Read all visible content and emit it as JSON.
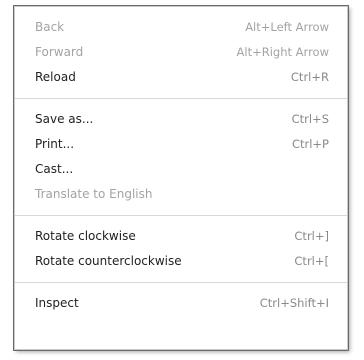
{
  "menu": {
    "groups": [
      [
        {
          "label": "Back",
          "shortcut": "Alt+Left Arrow",
          "disabled": true
        },
        {
          "label": "Forward",
          "shortcut": "Alt+Right Arrow",
          "disabled": true
        },
        {
          "label": "Reload",
          "shortcut": "Ctrl+R",
          "disabled": false
        }
      ],
      [
        {
          "label": "Save as...",
          "shortcut": "Ctrl+S",
          "disabled": false
        },
        {
          "label": "Print...",
          "shortcut": "Ctrl+P",
          "disabled": false
        },
        {
          "label": "Cast...",
          "shortcut": "",
          "disabled": false
        },
        {
          "label": "Translate to English",
          "shortcut": "",
          "disabled": true
        }
      ],
      [
        {
          "label": "Rotate clockwise",
          "shortcut": "Ctrl+]",
          "disabled": false
        },
        {
          "label": "Rotate counterclockwise",
          "shortcut": "Ctrl+[",
          "disabled": false
        }
      ],
      [
        {
          "label": "Inspect",
          "shortcut": "Ctrl+Shift+I",
          "disabled": false
        }
      ]
    ]
  }
}
